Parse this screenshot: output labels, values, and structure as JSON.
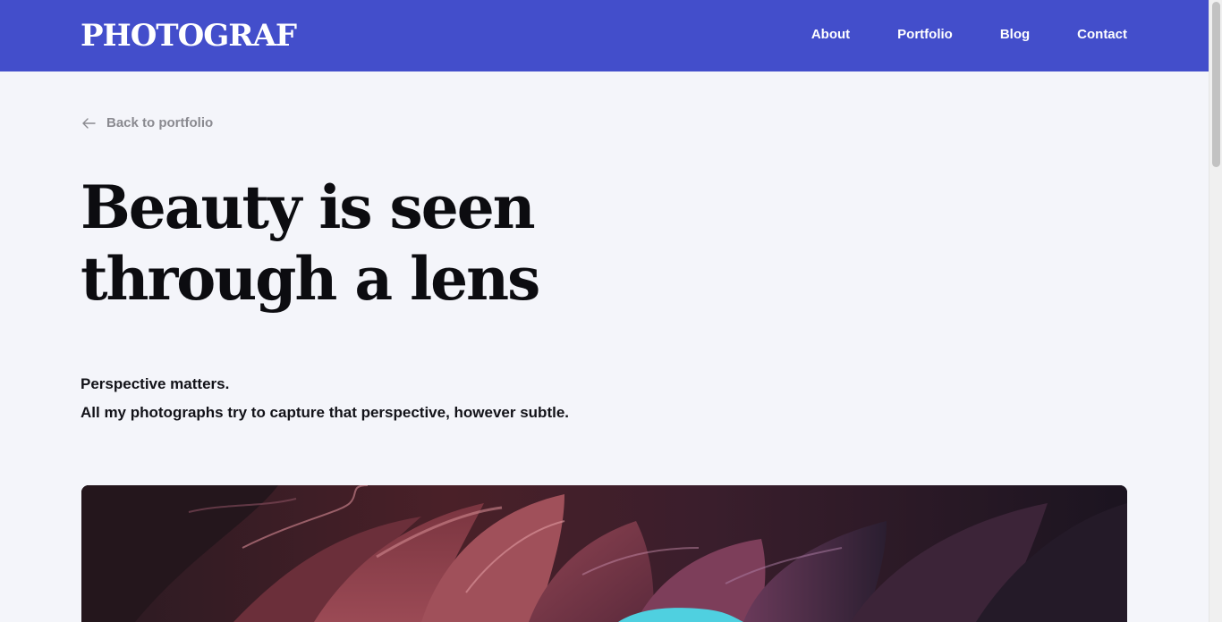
{
  "header": {
    "logo": "PHOTOGRAF",
    "nav": [
      {
        "label": "About"
      },
      {
        "label": "Portfolio"
      },
      {
        "label": "Blog"
      },
      {
        "label": "Contact"
      }
    ]
  },
  "back_link": {
    "label": "Back to portfolio",
    "icon": "arrow-left-icon"
  },
  "headline": {
    "line1": "Beauty is seen",
    "line2": "through a lens"
  },
  "intro": {
    "line1": "Perspective matters.",
    "line2": "All my photographs try to capture that perspective, however subtle."
  },
  "colors": {
    "header_bg": "#434ecb",
    "page_bg": "#f4f5fa",
    "text_dark": "#0c0c10",
    "muted": "#8a8a90"
  }
}
